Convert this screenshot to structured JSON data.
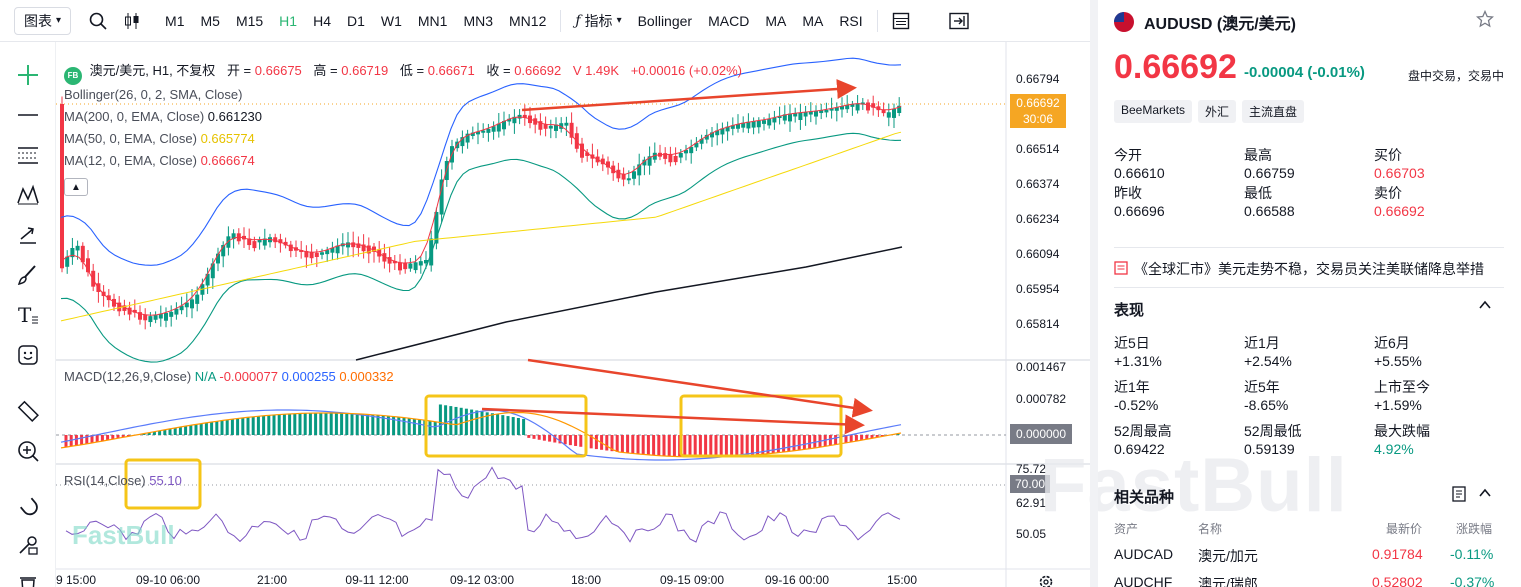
{
  "toolbar": {
    "chart_dropdown": "图表",
    "timeframes": [
      "M1",
      "M5",
      "M15",
      "H1",
      "H4",
      "D1",
      "W1",
      "MN1",
      "MN3",
      "MN12"
    ],
    "active_timeframe": "H1",
    "indicators_label": "指标",
    "indicators": [
      "Bollinger",
      "MACD",
      "MA",
      "MA",
      "RSI"
    ]
  },
  "legend": {
    "badge": "FB",
    "symbol_line": "澳元/美元, H1, 不复权",
    "open_label": "开 =",
    "open": "0.66675",
    "high_label": "高 =",
    "high": "0.66719",
    "low_label": "低 =",
    "low": "0.66671",
    "close_label": "收 =",
    "close": "0.66692",
    "volume": "V 1.49K",
    "change": "+0.00016 (+0.02%)",
    "bollinger": "Bollinger(26, 0, 2, SMA, Close)",
    "ma200_label": "MA(200, 0, EMA, Close)",
    "ma200": "0.661230",
    "ma50_label": "MA(50, 0, EMA, Close)",
    "ma50": "0.665774",
    "ma12_label": "MA(12, 0, EMA, Close)",
    "ma12": "0.666674",
    "macd_label": "MACD(12,26,9,Close)",
    "macd_na": "N/A",
    "macd_hist": "-0.000077",
    "macd_line": "0.000255",
    "macd_signal": "0.000332",
    "rsi_label": "RSI(14,Close)",
    "rsi": "55.10"
  },
  "price_axis": [
    "0.66794",
    "0.66654",
    "0.66514",
    "0.66374",
    "0.66234",
    "0.66094",
    "0.65954",
    "0.65814"
  ],
  "price_tag": {
    "price": "0.66692",
    "countdown": "30:06"
  },
  "macd_axis": [
    "0.001467",
    "0.000782"
  ],
  "macd_zero": "0.000000",
  "rsi_axis": [
    "75.72",
    "62.91",
    "50.05"
  ],
  "rsi_tag": "70.00",
  "time_axis": [
    "9 15:00",
    "09-10 06:00",
    "21:00",
    "09-11 12:00",
    "09-12 03:00",
    "18:00",
    "09-15 09:00",
    "09-16 00:00",
    "15:00"
  ],
  "watermark": "FastBull",
  "colors": {
    "up": "#089981",
    "down": "#f23645",
    "bb": "#2962ff",
    "bb_mid": "#f23645",
    "ma50": "#ffeb3b",
    "ma200": "#131722",
    "macd": "#5b7cfa",
    "signal": "#ff9800",
    "rsi": "#7e57c2",
    "highlight": "#f5c518",
    "arrow": "#e8452c"
  },
  "quote": {
    "symbol": "AUDUSD (澳元/美元)",
    "price": "0.66692",
    "change": "-0.00004",
    "change_pct": "(-0.01%)",
    "market_state": "盘中交易，交易中",
    "tags": [
      "BeeMarkets",
      "外汇",
      "主流直盘"
    ],
    "stats": [
      {
        "label": "今开",
        "value": "0.66610",
        "color": ""
      },
      {
        "label": "最高",
        "value": "0.66759",
        "color": ""
      },
      {
        "label": "买价",
        "value": "0.66703",
        "color": "#f23645"
      },
      {
        "label": "昨收",
        "value": "0.66696",
        "color": ""
      },
      {
        "label": "最低",
        "value": "0.66588",
        "color": ""
      },
      {
        "label": "卖价",
        "value": "0.66692",
        "color": "#f23645"
      }
    ],
    "news": "《全球汇市》美元走势不稳，交易员关注美联储降息举措",
    "performance_title": "表现",
    "performance": [
      {
        "label": "近5日",
        "value": "+1.31%",
        "color": ""
      },
      {
        "label": "近1月",
        "value": "+2.54%",
        "color": ""
      },
      {
        "label": "近6月",
        "value": "+5.55%",
        "color": ""
      },
      {
        "label": "近1年",
        "value": "-0.52%",
        "color": ""
      },
      {
        "label": "近5年",
        "value": "-8.65%",
        "color": ""
      },
      {
        "label": "上市至今",
        "value": "+1.59%",
        "color": ""
      },
      {
        "label": "52周最高",
        "value": "0.69422",
        "color": ""
      },
      {
        "label": "52周最低",
        "value": "0.59139",
        "color": ""
      },
      {
        "label": "最大跌幅",
        "value": "4.92%",
        "color": "#089981"
      }
    ],
    "related_title": "相关品种",
    "related_headers": [
      "资产",
      "名称",
      "最新价",
      "涨跌幅"
    ],
    "related": [
      {
        "code": "AUDCAD",
        "name": "澳元/加元",
        "price": "0.91784",
        "pct": "-0.11%"
      },
      {
        "code": "AUDCHF",
        "name": "澳元/瑞郎",
        "price": "0.52802",
        "pct": "-0.37%"
      }
    ]
  }
}
